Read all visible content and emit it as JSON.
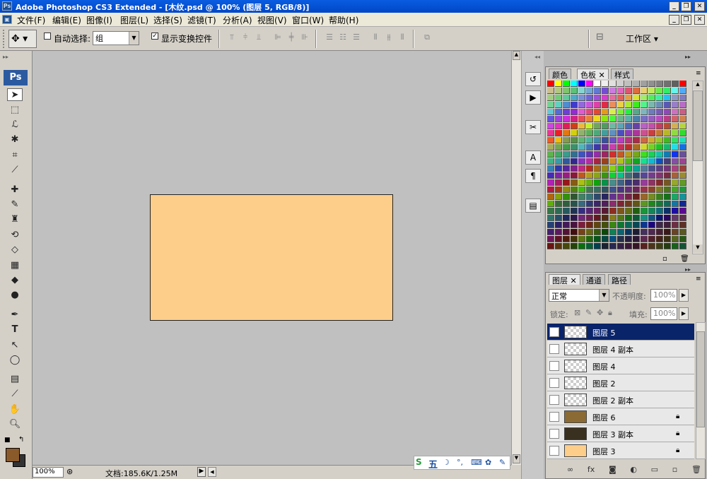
{
  "window": {
    "title": "Adobe Photoshop CS3 Extended - [木纹.psd @ 100% (图层 5, RGB/8)]",
    "app_icon": "Ps"
  },
  "menu": [
    "文件(F)",
    "编辑(E)",
    "图像(I)",
    "图层(L)",
    "选择(S)",
    "滤镜(T)",
    "分析(A)",
    "视图(V)",
    "窗口(W)",
    "帮助(H)"
  ],
  "options": {
    "auto_select_label": "自动选择:",
    "auto_select_value": "组",
    "show_transform_label": "显示变换控件",
    "workspace_label": "工作区 ▾"
  },
  "toolbox": {
    "logo": "Ps",
    "foreground_color": "#8b5a2b",
    "background_color": "#333333"
  },
  "document": {
    "fill_color": "#fcce8a"
  },
  "status": {
    "zoom": "100%",
    "doc_info": "文档:185.6K/1.25M"
  },
  "swatch_panel": {
    "tabs": [
      "颜色",
      "色板",
      "样式"
    ],
    "active_tab": "色板"
  },
  "layers_panel": {
    "tabs": [
      "图层",
      "通道",
      "路径"
    ],
    "active_tab": "图层",
    "blend_mode": "正常",
    "opacity_label": "不透明度:",
    "opacity_value": "100%",
    "lock_label": "锁定:",
    "fill_label": "填充:",
    "fill_value": "100%",
    "layers": [
      {
        "name": "图层 5",
        "selected": true,
        "thumb": "checker",
        "locked": false
      },
      {
        "name": "图层 4 副本",
        "selected": false,
        "thumb": "checker",
        "locked": false
      },
      {
        "name": "图层 4",
        "selected": false,
        "thumb": "checker",
        "locked": false
      },
      {
        "name": "图层 2",
        "selected": false,
        "thumb": "checker",
        "locked": false
      },
      {
        "name": "图层 2 副本",
        "selected": false,
        "thumb": "checker",
        "locked": false
      },
      {
        "name": "图层 6",
        "selected": false,
        "thumb": "#8b6a34",
        "locked": true
      },
      {
        "name": "图层 3 副本",
        "selected": false,
        "thumb": "#3a3020",
        "locked": true
      },
      {
        "name": "图层 3",
        "selected": false,
        "thumb": "#fcce8a",
        "locked": true
      }
    ]
  },
  "ime": {
    "mode": "五"
  }
}
